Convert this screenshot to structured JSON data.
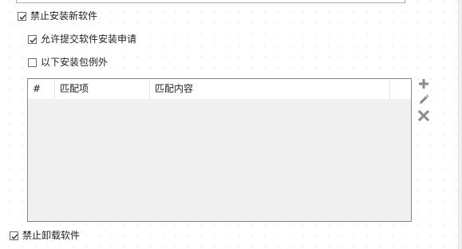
{
  "options": {
    "forbid_install": {
      "label": "禁止安装新软件",
      "checked": true
    },
    "allow_request": {
      "label": "允许提交软件安装申请",
      "checked": true
    },
    "except_packages": {
      "label": "以下安装包例外",
      "checked": false
    },
    "forbid_uninstall": {
      "label": "禁止卸载软件",
      "checked": true
    }
  },
  "exception_table": {
    "columns": [
      "#",
      "匹配项",
      "匹配内容",
      ""
    ],
    "rows": []
  },
  "toolbar": {
    "add_icon": "plus-icon",
    "edit_icon": "pencil-icon",
    "delete_icon": "x-icon"
  },
  "colors": {
    "icon_gray": "#8a8a8a",
    "grid_background": "#f0f0f0",
    "grid_border": "#828790"
  }
}
